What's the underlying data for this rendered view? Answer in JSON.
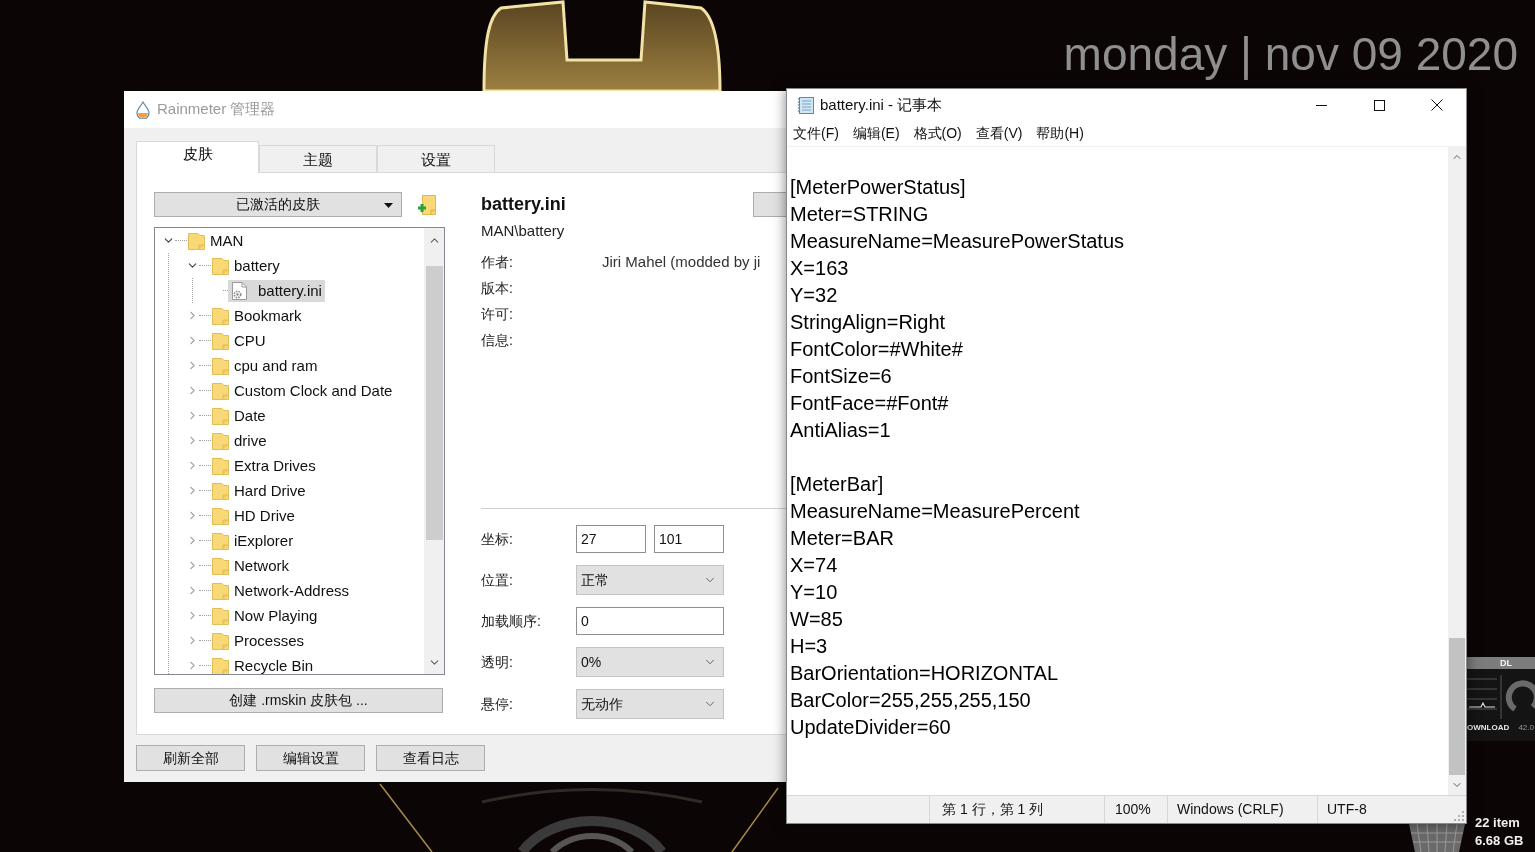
{
  "desktop": {
    "date": "monday | nov 09 2020",
    "download_widget": {
      "title": "DL",
      "label": "OWNLOAD",
      "reading": "42.0"
    },
    "folder_info": {
      "count": "22 item",
      "size": "6.68 GB"
    }
  },
  "rainmeter": {
    "title": "Rainmeter 管理器",
    "tabs": [
      {
        "label": "皮肤",
        "selected": true
      },
      {
        "label": "主题",
        "selected": false
      },
      {
        "label": "设置",
        "selected": false
      }
    ],
    "skin_filter": "已激活的皮肤",
    "tree": [
      {
        "label": "MAN",
        "kind": "folder",
        "expanded": true,
        "selected": false,
        "children": [
          {
            "label": "battery",
            "kind": "folder",
            "expanded": true,
            "selected": false,
            "children": [
              {
                "label": "battery.ini",
                "kind": "file",
                "selected": true
              }
            ]
          },
          {
            "label": "Bookmark",
            "kind": "folder",
            "expanded": false,
            "selected": false
          },
          {
            "label": "CPU",
            "kind": "folder",
            "expanded": false,
            "selected": false
          },
          {
            "label": "cpu and ram",
            "kind": "folder",
            "expanded": false,
            "selected": false
          },
          {
            "label": "Custom Clock and Date",
            "kind": "folder",
            "expanded": false,
            "selected": false
          },
          {
            "label": "Date",
            "kind": "folder",
            "expanded": false,
            "selected": false
          },
          {
            "label": "drive",
            "kind": "folder",
            "expanded": false,
            "selected": false
          },
          {
            "label": "Extra Drives",
            "kind": "folder",
            "expanded": false,
            "selected": false
          },
          {
            "label": "Hard Drive",
            "kind": "folder",
            "expanded": false,
            "selected": false
          },
          {
            "label": "HD Drive",
            "kind": "folder",
            "expanded": false,
            "selected": false
          },
          {
            "label": "iExplorer",
            "kind": "folder",
            "expanded": false,
            "selected": false
          },
          {
            "label": "Network",
            "kind": "folder",
            "expanded": false,
            "selected": false
          },
          {
            "label": "Network-Address",
            "kind": "folder",
            "expanded": false,
            "selected": false
          },
          {
            "label": "Now Playing",
            "kind": "folder",
            "expanded": false,
            "selected": false
          },
          {
            "label": "Processes",
            "kind": "folder",
            "expanded": false,
            "selected": false
          },
          {
            "label": "Recycle Bin",
            "kind": "folder",
            "expanded": false,
            "selected": false
          }
        ]
      }
    ],
    "create_button": "创建 .rmskin 皮肤包 ...",
    "skin": {
      "name": "battery.ini",
      "path": "MAN\\battery",
      "info": [
        {
          "label": "作者:",
          "value": "Jiri Mahel (modded by ji"
        },
        {
          "label": "版本:"
        },
        {
          "label": "许可:"
        },
        {
          "label": "信息:"
        }
      ]
    },
    "settings": [
      {
        "kind": "pair",
        "label": "坐标:",
        "values": [
          "27",
          "101"
        ]
      },
      {
        "kind": "select",
        "label": "位置:",
        "value": "正常"
      },
      {
        "kind": "input",
        "label": "加载顺序:",
        "value": "0"
      },
      {
        "kind": "select",
        "label": "透明:",
        "value": "0%"
      },
      {
        "kind": "select",
        "label": "悬停:",
        "value": "无动作"
      }
    ],
    "buttons": [
      "刷新全部",
      "编辑设置",
      "查看日志"
    ]
  },
  "notepad": {
    "title": "battery.ini - 记事本",
    "menu": [
      "文件(F)",
      "编辑(E)",
      "格式(O)",
      "查看(V)",
      "帮助(H)"
    ],
    "sections": [
      {
        "lines": [
          "[MeterPowerStatus]",
          "Meter=STRING",
          "MeasureName=MeasurePowerStatus",
          "X=163",
          "Y=32",
          "StringAlign=Right",
          "FontColor=#White#",
          "FontSize=6",
          "FontFace=#Font#",
          "AntiAlias=1"
        ]
      },
      {
        "lines": [
          "[MeterBar]",
          "MeasureName=MeasurePercent",
          "Meter=BAR",
          "X=74",
          "Y=10",
          "W=85",
          "H=3",
          "BarOrientation=HORIZONTAL",
          "BarColor=255,255,255,150",
          "UpdateDivider=60"
        ]
      }
    ],
    "status": [
      "第 1 行，第 1 列",
      "100%",
      "Windows (CRLF)",
      "UTF-8"
    ]
  }
}
